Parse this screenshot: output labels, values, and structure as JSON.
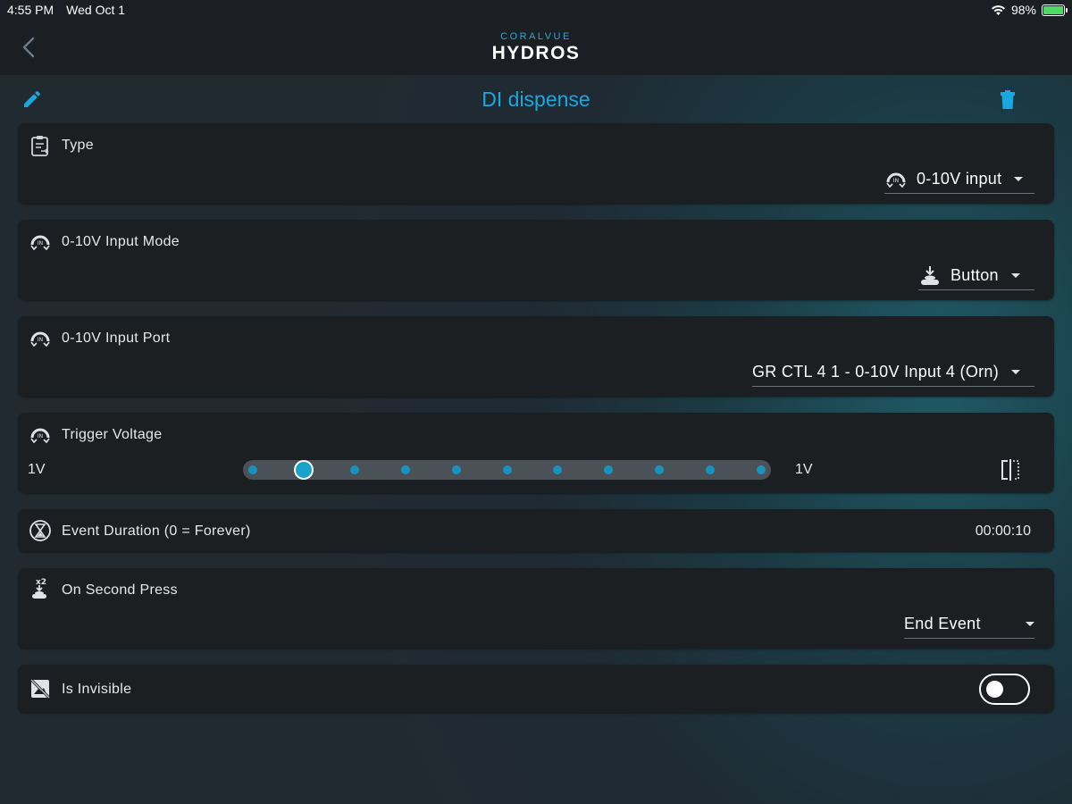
{
  "status_bar": {
    "time": "4:55 PM",
    "date": "Wed Oct 1",
    "battery": "98%",
    "battery_level": 0.98
  },
  "header": {
    "brand": "CORALVUE",
    "product": "HYDROS"
  },
  "title": "DI dispense",
  "colors": {
    "accent": "#19a8e0",
    "card": "#1c1f22",
    "slider_dot": "#1893bf",
    "battery": "#4cd964"
  },
  "rows": {
    "type": {
      "label": "Type",
      "icon": "clipboard-icon",
      "value": "0-10V input",
      "value_icon": "input-port-icon"
    },
    "input_mode": {
      "label": "0-10V Input Mode",
      "icon": "input-port-icon",
      "value": "Button",
      "value_icon": "push-button-icon"
    },
    "input_port": {
      "label": "0-10V Input Port",
      "icon": "input-port-icon",
      "value": "GR CTL 4 1 - 0-10V Input 4 (Orn)"
    },
    "trigger_voltage": {
      "label": "Trigger Voltage",
      "icon": "input-port-icon",
      "min_label": "1V",
      "value_label": "1V",
      "steps": 11,
      "selected_index": 1
    },
    "event_duration": {
      "label": "Event Duration (0 = Forever)",
      "icon": "hourglass-icon",
      "value": "00:00:10"
    },
    "second_press": {
      "label": "On Second Press",
      "icon": "double-press-icon",
      "value": "End Event"
    },
    "invisible": {
      "label": "Is Invisible",
      "icon": "hidden-image-icon",
      "enabled": false
    }
  }
}
